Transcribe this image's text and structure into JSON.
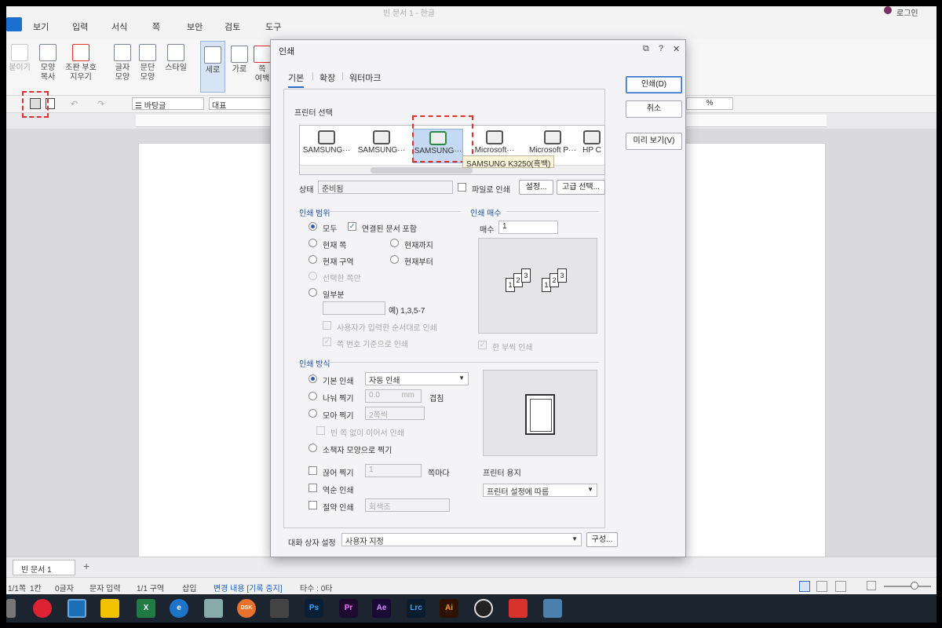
{
  "window": {
    "title": "빈 문서 1 - 한글",
    "login": "로그인"
  },
  "menu": [
    "보기",
    "입력",
    "서식",
    "쪽",
    "보안",
    "검토",
    "도구"
  ],
  "ribbon": {
    "paste": "붙이기",
    "shape_copy": "모양\n복사",
    "clear_format": "조판 부호\n지우기",
    "char_shape": "글자\n모양",
    "para_shape": "문단\n모양",
    "style": "스타일",
    "portrait": "세로",
    "landscape": "가로",
    "page": "쪽\n여백"
  },
  "format_bar": {
    "style": "바탕글",
    "font": "대표",
    "unit": "%"
  },
  "dialog": {
    "title": "인쇄",
    "tabs": [
      "기본",
      "확장",
      "워터마크"
    ],
    "buttons": {
      "print": "인쇄(D)",
      "cancel": "취소",
      "preview": "미리 보기(V)",
      "settings": "설정...",
      "advanced": "고급 선택...",
      "configure": "구성..."
    },
    "printer_select_label": "프린터 선택",
    "printers": [
      "SAMSUNG···",
      "SAMSUNG···",
      "SAMSUNG···",
      "Microsoft···",
      "Microsoft P···",
      "HP C"
    ],
    "tooltip": "SAMSUNG K3250(흑백)",
    "status_label": "상태",
    "status_value": "준비됨",
    "print_to_file": "파일로 인쇄",
    "range": {
      "title": "인쇄 범위",
      "all": "모두",
      "include_linked": "연결된 문서 포함",
      "current_page": "현재 쪽",
      "to_current": "현재까지",
      "current_section": "현재 구역",
      "from_current": "현재부터",
      "selected_only": "선택한 쪽만",
      "partial": "일부분",
      "partial_hint": "예) 1,3,5-7",
      "user_order": "사용자가 입력한 순서대로 인쇄",
      "page_number_based": "쪽 번호 기준으로 인쇄"
    },
    "copies": {
      "title": "인쇄 매수",
      "label": "매수",
      "value": "1",
      "collate": "한 부씩 인쇄"
    },
    "method": {
      "title": "인쇄 방식",
      "basic": "기본 인쇄",
      "basic_value": "자동 인쇄",
      "split": "나눠 찍기",
      "split_value": "0.0",
      "split_unit": "mm",
      "overlap": "겹침",
      "collect": "모아 찍기",
      "collect_value": "2쪽씩",
      "no_blank": "빈 쪽 없이 이어서 인쇄",
      "booklet": "소책자 모양으로 찍기",
      "cut": "끊어 찍기",
      "cut_value": "1",
      "cut_unit": "쪽마다",
      "reverse": "역순 인쇄",
      "saving": "절약 인쇄",
      "saving_value": "회색조"
    },
    "paper": {
      "label": "프린터 용지",
      "value": "프린터 설정에 따름"
    },
    "dialog_setting": {
      "label": "대화 상자 설정",
      "value": "사용자 지정"
    }
  },
  "tab_bar": {
    "doc": "빈 문서 1",
    "add": "+"
  },
  "status": {
    "page": "1/1쪽",
    "col": "1칸",
    "chars": "0글자",
    "mode": "문자 입력",
    "section": "1/1 구역",
    "insert": "삽입",
    "track": "변경 내용 [기록 중지]",
    "keys": "타수 : 0타"
  },
  "taskbar": [
    "chrome",
    "hwp",
    "sticky",
    "excel",
    "ie",
    "paint",
    "dsk",
    "calc",
    "Ps",
    "Pr",
    "Ae",
    "Lrc",
    "Ai",
    "obs",
    "app",
    "display"
  ]
}
